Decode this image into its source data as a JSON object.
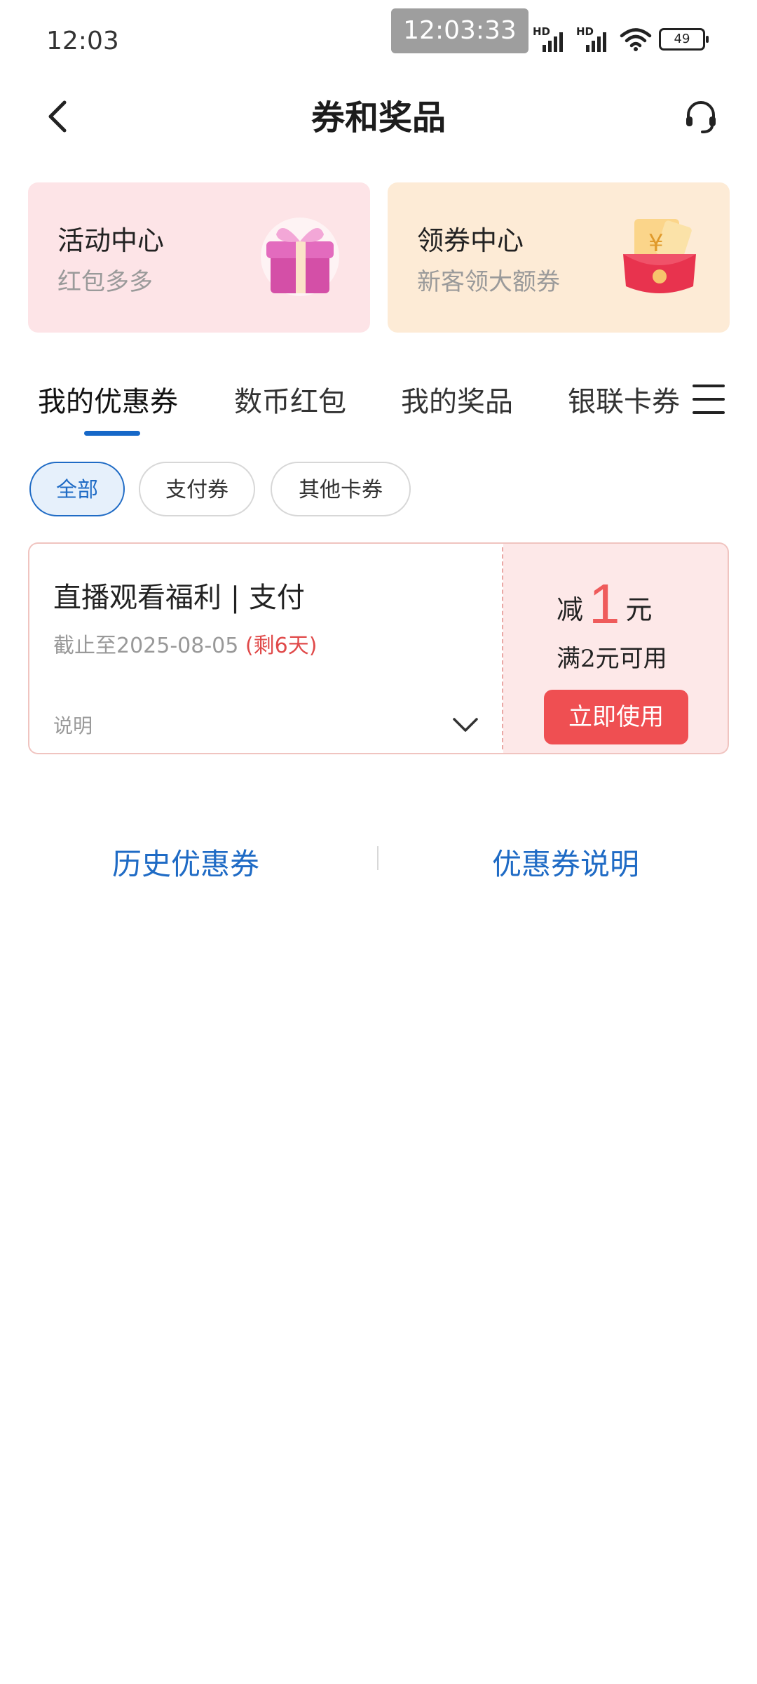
{
  "status_bar": {
    "time": "12:03",
    "overlay_time": "12:03:33",
    "sim1_tag": "HD",
    "sim2_tag": "HD",
    "battery": "49"
  },
  "header": {
    "title": "券和奖品",
    "back_icon": "back-arrow-icon",
    "support_icon": "headset-icon"
  },
  "banners": [
    {
      "title": "活动中心",
      "subtitle": "红包多多",
      "icon": "gift-box-icon"
    },
    {
      "title": "领券中心",
      "subtitle": "新客领大额券",
      "icon": "red-envelope-icon"
    }
  ],
  "tabs": [
    {
      "label": "我的优惠券",
      "active": true
    },
    {
      "label": "数币红包",
      "active": false
    },
    {
      "label": "我的奖品",
      "active": false
    },
    {
      "label": "银联卡券",
      "active": false
    }
  ],
  "filters": [
    {
      "label": "全部",
      "active": true
    },
    {
      "label": "支付券",
      "active": false
    },
    {
      "label": "其他卡券",
      "active": false
    }
  ],
  "coupon": {
    "title": "直播观看福利 | 支付",
    "expire_prefix": "截止至2025-08-05",
    "remaining": "(剩6天)",
    "note_label": "说明",
    "reduce_prefix": "减",
    "amount": "1",
    "unit": "元",
    "condition": "满2元可用",
    "use_button": "立即使用"
  },
  "links": {
    "history": "历史优惠券",
    "explain": "优惠券说明"
  },
  "colors": {
    "accent_blue": "#1f6bc5",
    "accent_red": "#ef4f52"
  }
}
